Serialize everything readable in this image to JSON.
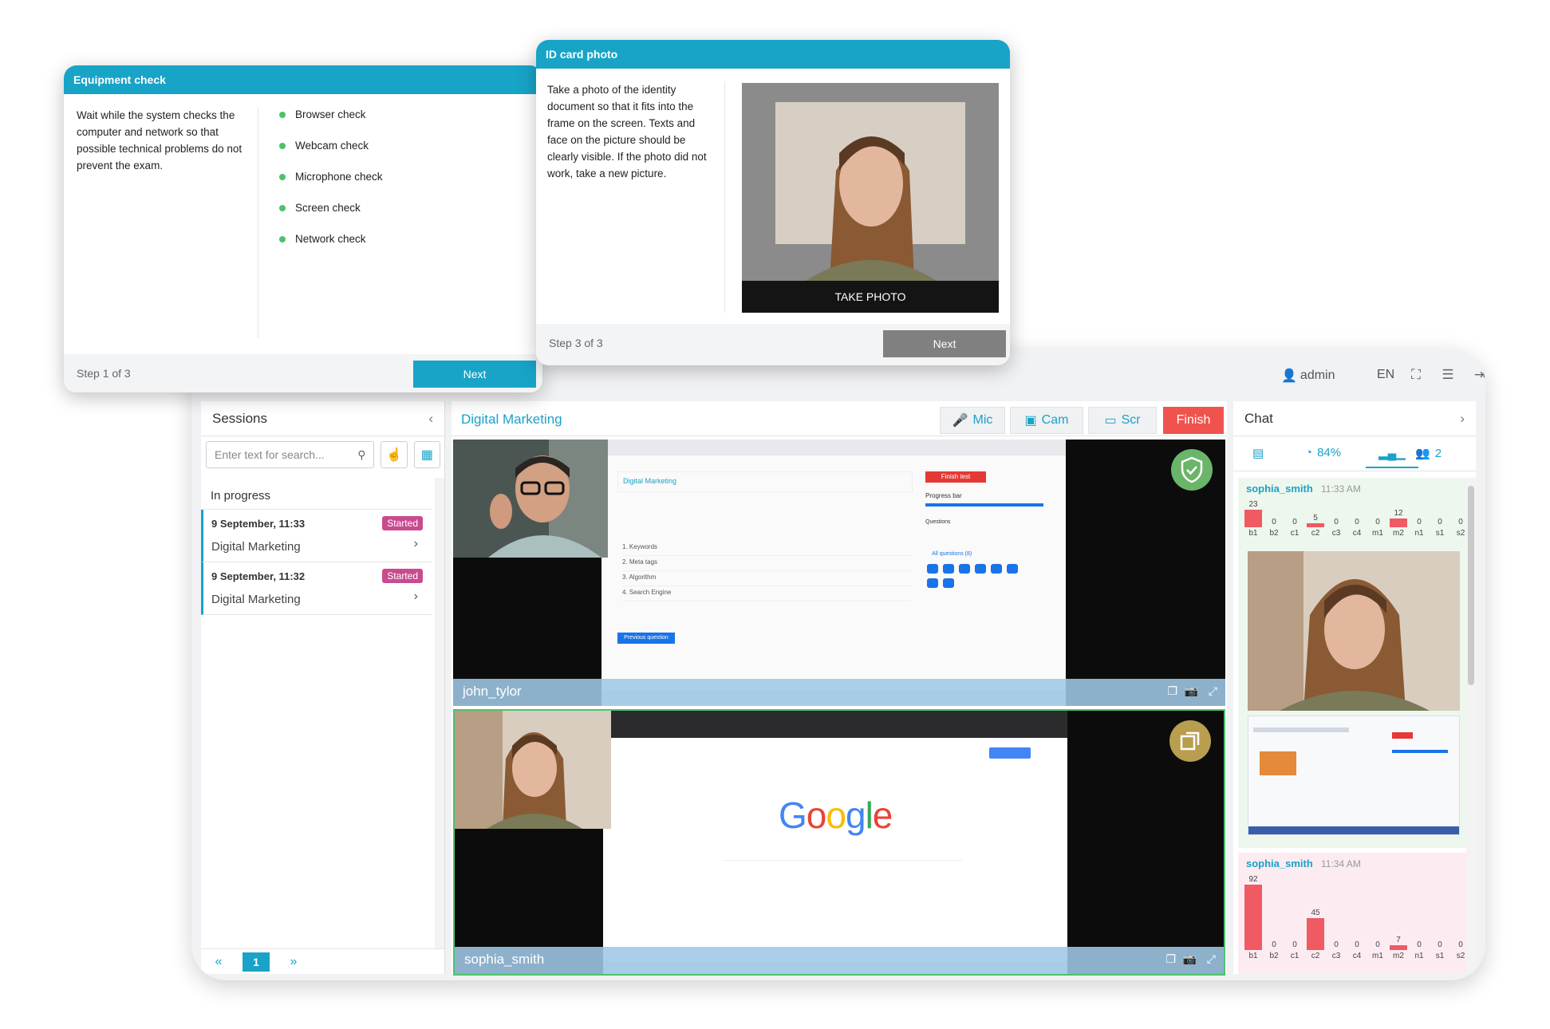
{
  "topbar": {
    "user": "admin",
    "language": "EN"
  },
  "sessions": {
    "title": "Sessions",
    "search_placeholder": "Enter text for search...",
    "section": "In progress",
    "items": [
      {
        "date": "9 September, 11:33",
        "status": "Started",
        "title": "Digital Marketing"
      },
      {
        "date": "9 September, 11:32",
        "status": "Started",
        "title": "Digital Marketing"
      }
    ],
    "page": "1",
    "prev": "«",
    "next": "»"
  },
  "center": {
    "title": "Digital Marketing",
    "mic": "Mic",
    "cam": "Cam",
    "scr": "Scr",
    "finish": "Finish",
    "feeds": [
      {
        "name": "john_tylor"
      },
      {
        "name": "sophia_smith"
      }
    ],
    "google_logo": "Google",
    "exam_title": "Digital Marketing",
    "finish_test": "Finish test",
    "progress_bar": "Progress bar",
    "answers": [
      "1. Keywords",
      "2. Meta tags",
      "3. Algorithm",
      "4. Search Engine"
    ],
    "prev_question": "Previous question",
    "questions_tab": "Questions",
    "all_questions": "All questions (8)"
  },
  "chat": {
    "title": "Chat",
    "percent": "84%",
    "participants": "2",
    "messages": [
      {
        "user": "sophia_smith",
        "time": "11:33 AM",
        "chart": {
          "categories": [
            "b1",
            "b2",
            "c1",
            "c2",
            "c3",
            "c4",
            "m1",
            "m2",
            "n1",
            "s1",
            "s2"
          ],
          "values": [
            23,
            0,
            0,
            5,
            0,
            0,
            0,
            12,
            0,
            0,
            0
          ]
        }
      },
      {
        "user": "sophia_smith",
        "time": "11:34 AM",
        "chart": {
          "categories": [
            "b1",
            "b2",
            "c1",
            "c2",
            "c3",
            "c4",
            "m1",
            "m2",
            "n1",
            "s1",
            "s2"
          ],
          "values": [
            92,
            0,
            0,
            45,
            0,
            0,
            0,
            7,
            0,
            0,
            0
          ]
        }
      }
    ]
  },
  "equipment": {
    "title": "Equipment check",
    "text": "Wait while the system checks the computer and network so that possible technical problems do not prevent the exam.",
    "checks": [
      "Browser check",
      "Webcam check",
      "Microphone check",
      "Screen check",
      "Network check"
    ],
    "step": "Step 1 of 3",
    "next": "Next"
  },
  "idcard": {
    "title": "ID card photo",
    "text": "Take a photo of the identity document so that it fits into the frame on the screen. Texts and face on the picture should be clearly visible. If the photo did not work, take a new picture.",
    "take_photo": "TAKE PHOTO",
    "step": "Step 3 of 3",
    "next": "Next"
  },
  "colors": {
    "accent": "#18a4c7",
    "finish": "#f0524d",
    "bar": "#ef5a63",
    "status_badge": "#c94b8f",
    "ok": "#4cc36b"
  }
}
